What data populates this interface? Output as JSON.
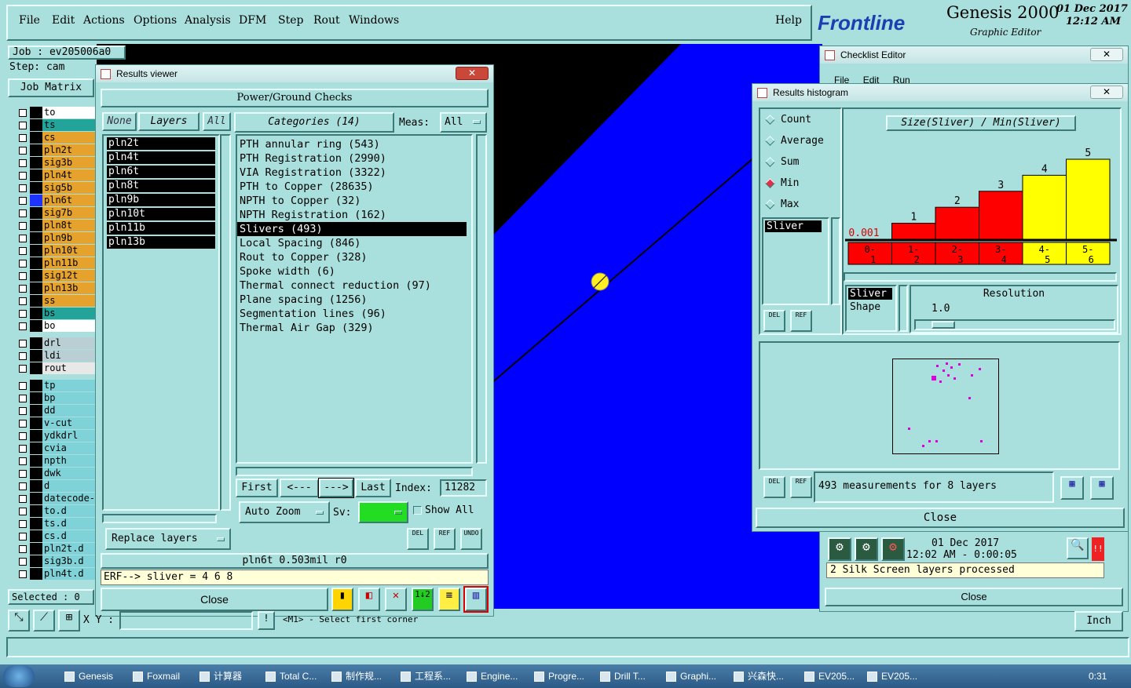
{
  "menu": {
    "items": [
      "File",
      "Edit",
      "Actions",
      "Options",
      "Analysis",
      "DFM",
      "Step",
      "Rout",
      "Windows"
    ],
    "help": "Help"
  },
  "brand": {
    "logo": "Frontline",
    "product": "Genesis 2000",
    "subtitle": "Graphic Editor",
    "date": "01 Dec 2017",
    "time": "12:12  AM"
  },
  "job": {
    "job_label": "Job : ev205006a0",
    "step_label": "Step: cam",
    "matrix_button": "Job Matrix"
  },
  "layers_group1": [
    {
      "name": "to",
      "color": "#ffffff"
    },
    {
      "name": "ts",
      "color": "#22a49a"
    },
    {
      "name": "cs",
      "color": "#e5a22c"
    },
    {
      "name": "pln2t",
      "color": "#e5a22c"
    },
    {
      "name": "sig3b",
      "color": "#e5a22c"
    },
    {
      "name": "pln4t",
      "color": "#e5a22c"
    },
    {
      "name": "sig5b",
      "color": "#e5a22c"
    },
    {
      "name": "pln6t",
      "color": "#e5a22c"
    },
    {
      "name": "sig7b",
      "color": "#e5a22c"
    },
    {
      "name": "pln8t",
      "color": "#e5a22c"
    },
    {
      "name": "pln9b",
      "color": "#e5a22c"
    },
    {
      "name": "pln10t",
      "color": "#e5a22c"
    },
    {
      "name": "pln11b",
      "color": "#e5a22c"
    },
    {
      "name": "sig12t",
      "color": "#e5a22c"
    },
    {
      "name": "pln13b",
      "color": "#e5a22c"
    },
    {
      "name": "ss",
      "color": "#e5a22c"
    },
    {
      "name": "bs",
      "color": "#22a49a"
    },
    {
      "name": "bo",
      "color": "#ffffff"
    }
  ],
  "layers_group2": [
    {
      "name": "drl",
      "color": "#b9cfd3"
    },
    {
      "name": "ldi",
      "color": "#b9cfd3"
    },
    {
      "name": "rout",
      "color": "#e8e8e8"
    }
  ],
  "layers_group3": [
    {
      "name": "tp",
      "color": "#7fd3d8"
    },
    {
      "name": "bp",
      "color": "#7fd3d8"
    },
    {
      "name": "dd",
      "color": "#7fd3d8"
    },
    {
      "name": "v-cut",
      "color": "#7fd3d8"
    },
    {
      "name": "ydkdrl",
      "color": "#7fd3d8"
    },
    {
      "name": "cvia",
      "color": "#7fd3d8"
    },
    {
      "name": "npth",
      "color": "#7fd3d8"
    },
    {
      "name": "dwk",
      "color": "#7fd3d8"
    },
    {
      "name": "d",
      "color": "#7fd3d8"
    },
    {
      "name": "datecode-p",
      "color": "#7fd3d8"
    },
    {
      "name": "to.d",
      "color": "#7fd3d8"
    },
    {
      "name": "ts.d",
      "color": "#7fd3d8"
    },
    {
      "name": "cs.d",
      "color": "#7fd3d8"
    },
    {
      "name": "pln2t.d",
      "color": "#7fd3d8"
    },
    {
      "name": "sig3b.d",
      "color": "#7fd3d8"
    },
    {
      "name": "pln4t.d",
      "color": "#7fd3d8"
    }
  ],
  "sidebar": {
    "selected": "Selected : 0"
  },
  "results_viewer": {
    "title": "Results viewer",
    "header": "Power/Ground Checks",
    "none_btn": "None",
    "layers_btn": "Layers",
    "all_btn": "All",
    "layers": [
      "pln2t",
      "pln4t",
      "pln6t",
      "pln8t",
      "pln9b",
      "pln10t",
      "pln11b",
      "pln13b"
    ],
    "categories_btn": "Categories (14)",
    "meas_label": "Meas:",
    "meas_value": "All",
    "categories": [
      "PTH annular ring (543)",
      "PTH Registration (2990)",
      "VIA Registration (3322)",
      "PTH to Copper (28635)",
      "NPTH to Copper (32)",
      "NPTH Registration (162)",
      "Slivers (493)",
      "Local Spacing (846)",
      "Rout to Copper (328)",
      "Spoke width (6)",
      "Thermal connect reduction (97)",
      "Plane spacing (1256)",
      "Segmentation lines (96)",
      "Thermal Air Gap (329)"
    ],
    "selected_category": "Slivers (493)",
    "nav": {
      "first": "First",
      "prev": "<---",
      "next": "--->",
      "last": "Last",
      "index_label": "Index:",
      "index_value": "11282"
    },
    "auto_zoom": "Auto Zoom",
    "sv_label": "Sv:",
    "show_all": "Show All",
    "replace_layers": "Replace layers",
    "del": "DEL",
    "ref": "REF",
    "undo": "UNDO",
    "status1": "pln6t 0.503mil   r0",
    "status2": "ERF--> sliver = 4 6 8",
    "close": "Close"
  },
  "checklist_editor": {
    "title": "Checklist Editor",
    "menu": [
      "File",
      "Edit",
      "Run"
    ],
    "date": "01 Dec 2017",
    "time": "12:02 AM - 0:00:05",
    "message": "2 Silk Screen layers processed",
    "close": "Close"
  },
  "histogram": {
    "title": "Results histogram",
    "radios": [
      {
        "label": "Count",
        "checked": false
      },
      {
        "label": "Average",
        "checked": false
      },
      {
        "label": "Sum",
        "checked": false
      },
      {
        "label": "Min",
        "checked": true
      },
      {
        "label": "Max",
        "checked": false
      }
    ],
    "list_item": "Sliver",
    "chart_title": "Size(Sliver) / Min(Sliver)",
    "min_label": "0.001",
    "resolution_label": "Resolution",
    "resolution_value": "1.0",
    "param_list": [
      "Sliver",
      "Shape"
    ],
    "del": "DEL",
    "ref": "REF",
    "summary": "493 measurements for 8 layers",
    "close": "Close"
  },
  "chart_data": {
    "type": "bar",
    "categories": [
      "0-1",
      "1-2",
      "2-3",
      "3-4",
      "4-5",
      "5-6"
    ],
    "values": [
      0,
      1,
      2,
      3,
      4,
      5
    ],
    "colors": [
      "#ff0000",
      "#ff0000",
      "#ff0000",
      "#ff0000",
      "#ffff00",
      "#ffff00"
    ],
    "title": "Size(Sliver) / Min(Sliver)",
    "xlabel": "",
    "ylabel": "",
    "ylim": [
      0,
      5
    ]
  },
  "bottom": {
    "xy_label": "X Y :",
    "hint": "<M1> - Select first corner",
    "units": "Inch"
  },
  "taskbar": {
    "items": [
      "Genesis",
      "Foxmail",
      "计算器",
      "Total C...",
      "制作规...",
      "工程系...",
      "Engine...",
      "Progre...",
      "Drill T...",
      "Graphi...",
      "兴森快...",
      "EV205...",
      "EV205..."
    ],
    "clock": "0:31"
  }
}
